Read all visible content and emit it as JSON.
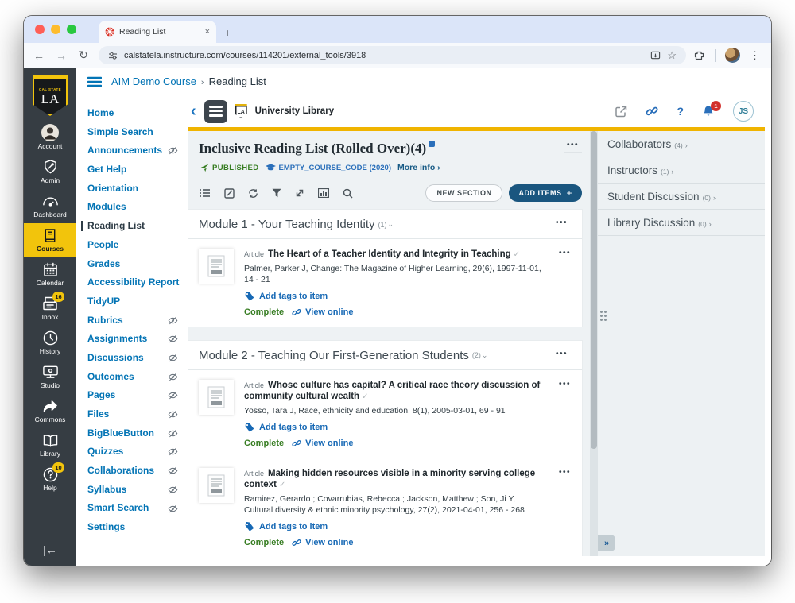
{
  "colors": {
    "gold_bar": "#F0B400",
    "courses_gold": "#F2C40C",
    "canvas_blue": "#0374B5",
    "lti_blue": "#1769B5",
    "green": "#377D22",
    "add_items_bg": "#1A567F",
    "badge_red": "#D2302C"
  },
  "browser": {
    "tab_title": "Reading List",
    "tab_close": "×",
    "new_tab": "+",
    "url": "calstatela.instructure.com/courses/114201/external_tools/3918",
    "menu_dots": "⋮"
  },
  "canvas_sidebar": {
    "logo_top": "CAL STATE",
    "logo_main": "LA",
    "collapse": "|←",
    "items": [
      {
        "name": "account",
        "label": "Account",
        "icon": "avatar-photo-icon"
      },
      {
        "name": "admin",
        "label": "Admin",
        "icon": "shield-icon"
      },
      {
        "name": "dashboard",
        "label": "Dashboard",
        "icon": "gauge-icon"
      },
      {
        "name": "courses",
        "label": "Courses",
        "icon": "book-icon",
        "active": true
      },
      {
        "name": "calendar",
        "label": "Calendar",
        "icon": "calendar-icon"
      },
      {
        "name": "inbox",
        "label": "Inbox",
        "icon": "inbox-icon",
        "badge": "16"
      },
      {
        "name": "history",
        "label": "History",
        "icon": "clock-icon"
      },
      {
        "name": "studio",
        "label": "Studio",
        "icon": "monitor-icon"
      },
      {
        "name": "commons",
        "label": "Commons",
        "icon": "share-arrow-icon"
      },
      {
        "name": "library",
        "label": "Library",
        "icon": "open-book-icon"
      },
      {
        "name": "help",
        "label": "Help",
        "icon": "help-circle-icon",
        "badge": "10"
      }
    ]
  },
  "breadcrumb": {
    "course": "AIM Demo Course",
    "separator": "›",
    "page": "Reading List"
  },
  "course_nav": [
    {
      "label": "Home"
    },
    {
      "label": "Simple Search"
    },
    {
      "label": "Announcements",
      "hidden": true
    },
    {
      "label": "Get Help"
    },
    {
      "label": "Orientation"
    },
    {
      "label": "Modules"
    },
    {
      "label": "Reading List",
      "active": true
    },
    {
      "label": "People"
    },
    {
      "label": "Grades"
    },
    {
      "label": "Accessibility Report"
    },
    {
      "label": "TidyUP"
    },
    {
      "label": "Rubrics",
      "hidden": true
    },
    {
      "label": "Assignments",
      "hidden": true
    },
    {
      "label": "Discussions",
      "hidden": true
    },
    {
      "label": "Outcomes",
      "hidden": true
    },
    {
      "label": "Pages",
      "hidden": true
    },
    {
      "label": "Files",
      "hidden": true
    },
    {
      "label": "BigBlueButton",
      "hidden": true
    },
    {
      "label": "Quizzes",
      "hidden": true
    },
    {
      "label": "Collaborations",
      "hidden": true
    },
    {
      "label": "Syllabus",
      "hidden": true
    },
    {
      "label": "Smart Search",
      "hidden": true
    },
    {
      "label": "Settings"
    }
  ],
  "lti": {
    "brand": "University Library",
    "mini_logo": "LA",
    "bell_badge": "1",
    "avatar_initials": "JS",
    "question_mark": "?",
    "kebab": "•••",
    "title": "Inclusive Reading List (Rolled Over)(4)",
    "published": "PUBLISHED",
    "course_code": "EMPTY_COURSE_CODE (2020)",
    "more_info": "More info ›",
    "new_section": "NEW SECTION",
    "add_items": "ADD ITEMS",
    "add_items_plus": "+"
  },
  "modules": [
    {
      "title": "Module 1 - Your Teaching Identity",
      "count": "(1)",
      "chevron": "⌄",
      "items": [
        {
          "type": "Article",
          "title": "The Heart of a Teacher Identity and Integrity in Teaching",
          "citation_lines": [
            "Palmer, Parker J, Change: The Magazine of Higher Learning, 29(6), 1997-11-01, 14 - 21"
          ],
          "tags_label": "Add tags to item",
          "status": "Complete",
          "view_label": "View online"
        }
      ]
    },
    {
      "title": "Module 2 - Teaching Our First-Generation Students",
      "count": "(2)",
      "chevron": "⌄",
      "items": [
        {
          "type": "Article",
          "title": "Whose culture has capital? A critical race theory discussion of community cultural wealth",
          "citation_lines": [
            "Yosso, Tara J, Race, ethnicity and education, 8(1), 2005-03-01, 69 - 91"
          ],
          "tags_label": "Add tags to item",
          "status": "Complete",
          "view_label": "View online"
        },
        {
          "type": "Article",
          "title": "Making hidden resources visible in a minority serving college context",
          "citation_lines": [
            "Ramirez, Gerardo ; Covarrubias, Rebecca ; Jackson, Matthew ; Son, Ji Y,",
            "Cultural diversity & ethnic minority psychology, 27(2), 2021-04-01, 256 - 268"
          ],
          "tags_label": "Add tags to item",
          "status": "Complete",
          "view_label": "View online"
        }
      ]
    }
  ],
  "right_panel": {
    "collapse": "»",
    "sections": [
      {
        "label": "Collaborators",
        "count": "(4)"
      },
      {
        "label": "Instructors",
        "count": "(1)"
      },
      {
        "label": "Student Discussion",
        "count": "(0)"
      },
      {
        "label": "Library Discussion",
        "count": "(0)"
      }
    ]
  }
}
